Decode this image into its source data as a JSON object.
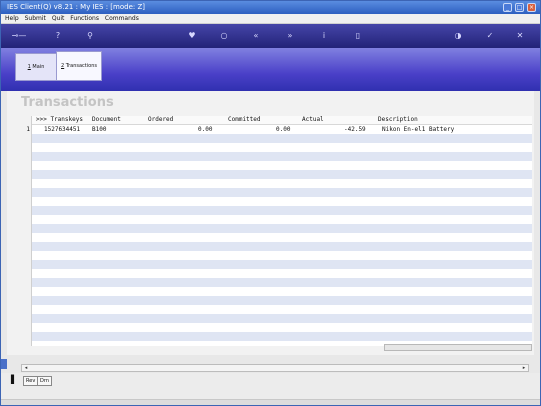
{
  "window": {
    "title": "IES Client(Q) v8.21 : My IES :      [mode: Z]"
  },
  "menu": [
    "Help",
    "Submit",
    "Quit",
    "Functions",
    "Commands"
  ],
  "toolbar_icons": [
    "key-icon",
    "help-icon",
    "search-icon",
    "heart-icon",
    "clock-icon",
    "rewind-icon",
    "fast-forward-icon",
    "info-icon",
    "document-icon",
    "lock-icon",
    "check-icon",
    "close-icon"
  ],
  "tabs": [
    {
      "key": "1",
      "label": "Main"
    },
    {
      "key": "2",
      "label": "Transactions"
    }
  ],
  "page_title": "Transactions",
  "grid": {
    "columns": [
      ">>> Transkeys",
      "Document",
      "Ordered",
      "Committed",
      "Actual",
      "Description"
    ],
    "rows": [
      {
        "num": "1",
        "transkeys": "1527634451",
        "document": "B100",
        "ordered": "0.00",
        "committed": "0.00",
        "actual": "-42.59",
        "description": "Nikon En-el1 Battery"
      }
    ]
  },
  "bottom": {
    "btn1": "Rev",
    "btn2": "Drn"
  },
  "colors": {
    "titlebar": "#2d5fc0",
    "toolbar": "#232378",
    "header_band": "#4a40c8",
    "row_stripe": "#dfe5f3"
  }
}
